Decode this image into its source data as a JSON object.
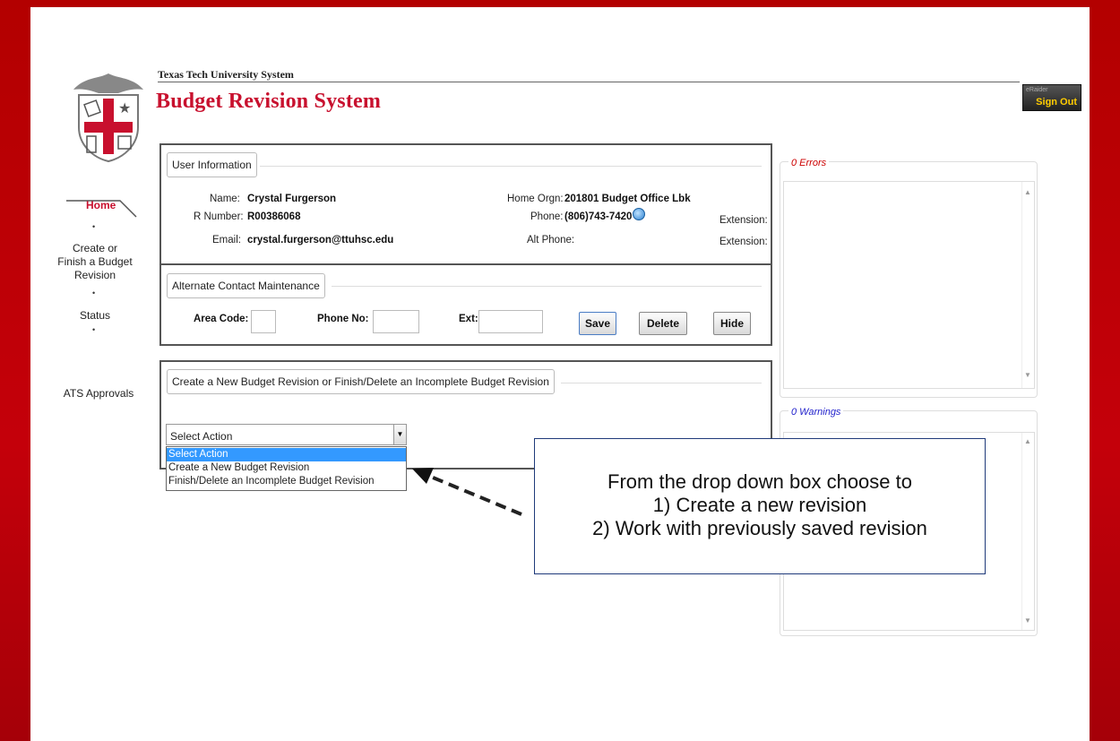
{
  "header": {
    "system_name": "Texas Tech University System",
    "app_title": "Budget Revision System",
    "signout_small": "eRaider",
    "signout_label": "Sign Out"
  },
  "nav": {
    "home": "Home",
    "create_finish_1": "Create or",
    "create_finish_2": "Finish a Budget",
    "create_finish_3": "Revision",
    "status": "Status",
    "ats_approvals": "ATS Approvals"
  },
  "user_info": {
    "legend": "User Information",
    "name_label": "Name:",
    "name_value": "Crystal Furgerson",
    "rnum_label": "R Number:",
    "rnum_value": "R00386068",
    "email_label": "Email:",
    "email_value": "crystal.furgerson@ttuhsc.edu",
    "home_orgn_label": "Home Orgn:",
    "home_orgn_value": "201801 Budget Office Lbk",
    "phone_label": "Phone:",
    "phone_value": "(806)743-7420",
    "alt_phone_label": "Alt Phone:",
    "extension_label": "Extension:"
  },
  "alt_contact": {
    "legend": "Alternate Contact Maintenance",
    "area_code_label": "Area Code:",
    "phone_no_label": "Phone No:",
    "ext_label": "Ext:",
    "save": "Save",
    "delete": "Delete",
    "hide": "Hide"
  },
  "revision": {
    "legend": "Create a New Budget Revision or Finish/Delete an Incomplete Budget Revision",
    "select_value": "Select Action",
    "options": [
      "Select Action",
      "Create a New Budget Revision",
      "Finish/Delete an Incomplete Budget Revision"
    ]
  },
  "errors_box": {
    "title": "0 Errors",
    "color": "#cc0000"
  },
  "warnings_box": {
    "title": "0 Warnings",
    "color": "#2222cc"
  },
  "callout": {
    "line1": "From the drop down box choose to",
    "line2": "1) Create a new revision",
    "line3": "2) Work with previously saved revision"
  }
}
